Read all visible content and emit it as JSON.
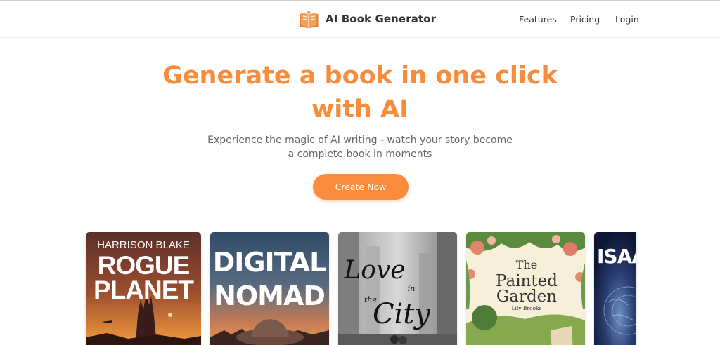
{
  "header": {
    "brand": "AI Book Generator",
    "nav": [
      {
        "label": "Features"
      },
      {
        "label": "Pricing"
      },
      {
        "label": "Login"
      }
    ]
  },
  "hero": {
    "title_line1": "Generate a book in one click",
    "title_line2": "with AI",
    "subtitle_line1": "Experience the magic of AI writing - watch your story become",
    "subtitle_line2": "a complete book in moments",
    "cta_label": "Create Now"
  },
  "books": [
    {
      "author": "HARRISON BLAKE",
      "title_line1": "ROGUE",
      "title_line2": "PLANET"
    },
    {
      "title_line1": "DIGITAL",
      "title_line2": "NOMAD"
    },
    {
      "title_line1": "Love",
      "title_line2": "in",
      "title_line3": "the",
      "title_line4": "City"
    },
    {
      "title_line1": "The",
      "title_line2": "Painted",
      "title_line3": "Garden",
      "author": "Lily Brooks"
    },
    {
      "title_fragment": "ISAA"
    }
  ],
  "colors": {
    "accent": "#f88c3c",
    "cta": "#fb8c3e"
  },
  "icons": {
    "brand": "open-book-icon"
  }
}
